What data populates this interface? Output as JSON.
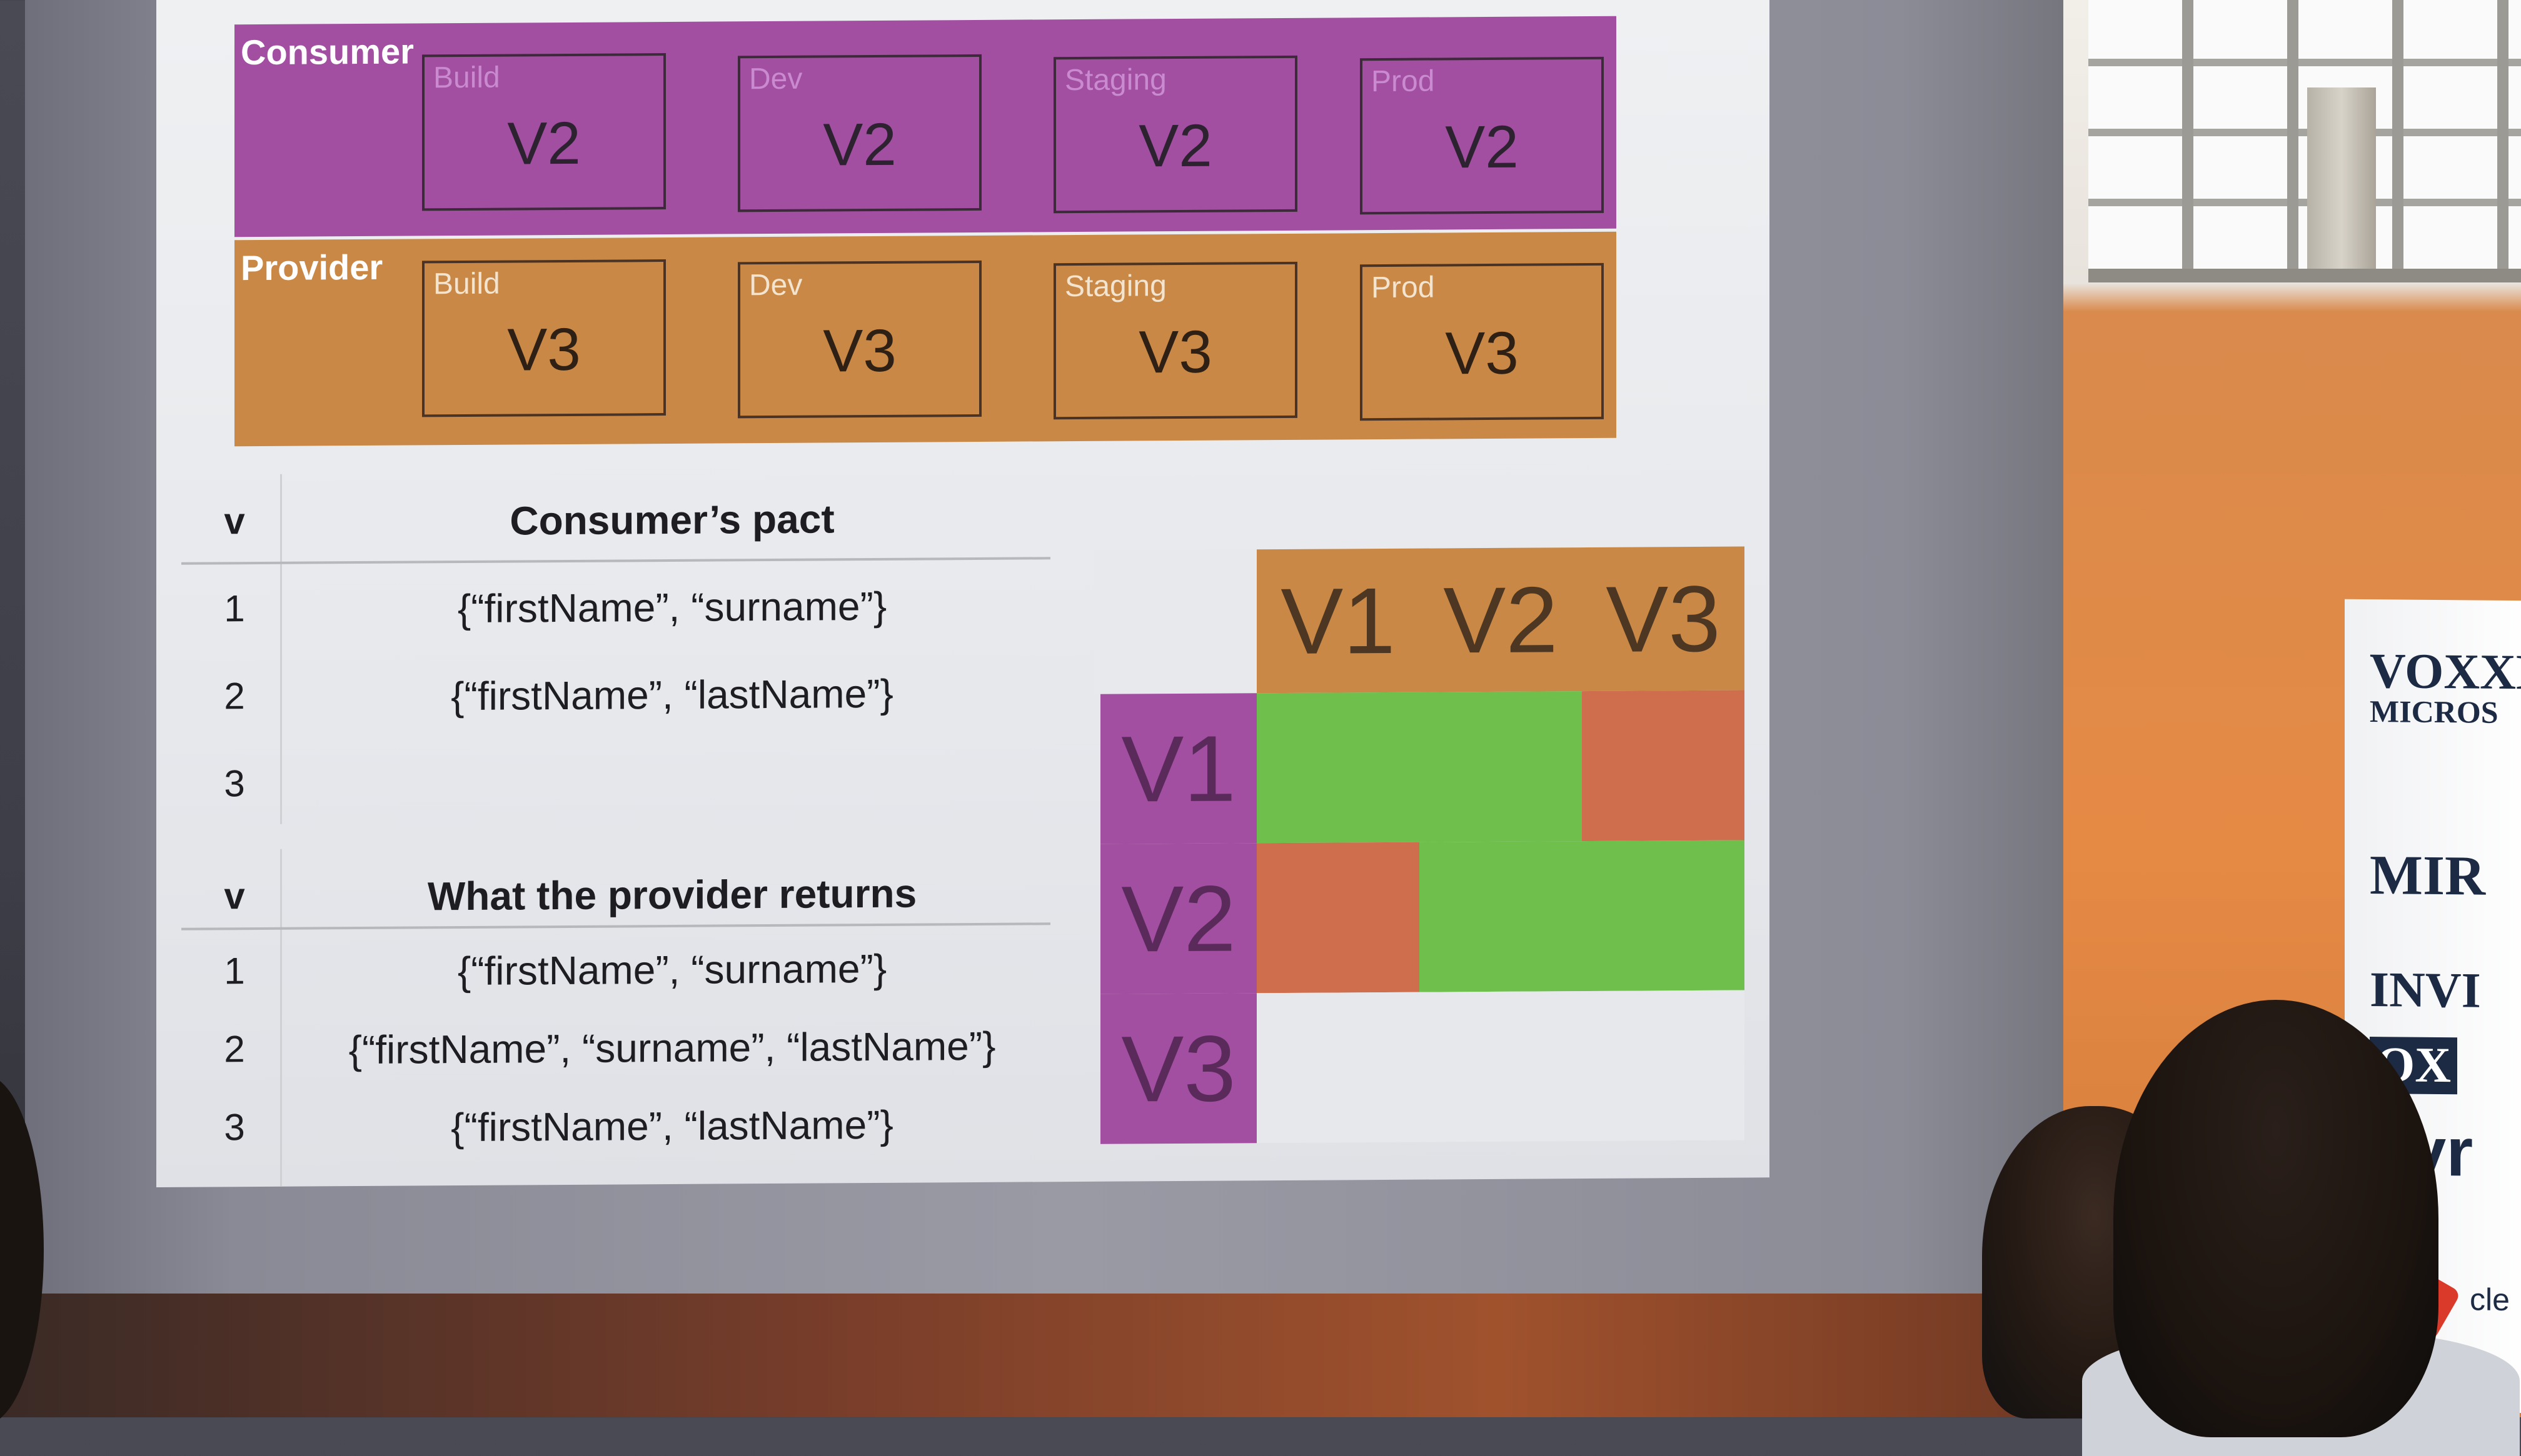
{
  "slide": {
    "consumer": {
      "label": "Consumer",
      "environments": [
        {
          "name": "Build",
          "version": "V2"
        },
        {
          "name": "Dev",
          "version": "V2"
        },
        {
          "name": "Staging",
          "version": "V2"
        },
        {
          "name": "Prod",
          "version": "V2"
        }
      ]
    },
    "provider": {
      "label": "Provider",
      "environments": [
        {
          "name": "Build",
          "version": "V3"
        },
        {
          "name": "Dev",
          "version": "V3"
        },
        {
          "name": "Staging",
          "version": "V3"
        },
        {
          "name": "Prod",
          "version": "V3"
        }
      ]
    },
    "consumer_pact_table": {
      "col_v": "v",
      "col_title": "Consumer’s pact",
      "rows": [
        {
          "v": "1",
          "value": "{“firstName”, “surname”}"
        },
        {
          "v": "2",
          "value": "{“firstName”, “lastName”}"
        },
        {
          "v": "3",
          "value": ""
        }
      ]
    },
    "provider_returns_table": {
      "col_v": "v",
      "col_title": "What the provider returns",
      "rows": [
        {
          "v": "1",
          "value": "{“firstName”, “surname”}"
        },
        {
          "v": "2",
          "value": "{“firstName”, “surname”, “lastName”}"
        },
        {
          "v": "3",
          "value": "{“firstName”, “lastName”}"
        }
      ]
    },
    "matrix": {
      "col_heads": [
        "V1",
        "V2",
        "V3"
      ],
      "row_heads": [
        "V1",
        "V2",
        "V3"
      ],
      "cells": [
        [
          "green",
          "green",
          "red"
        ],
        [
          "red",
          "green",
          "green"
        ],
        [
          "empty",
          "empty",
          "empty"
        ]
      ],
      "colors": {
        "green": "#6fbf4d",
        "red": "#cf6e4d",
        "consumer": "#a24ea1",
        "provider": "#c98845"
      }
    }
  },
  "banner": {
    "lines": [
      "VOXXE",
      "MICROS",
      "MIR",
      "INVI",
      "OX",
      "kyr",
      "cle"
    ]
  }
}
